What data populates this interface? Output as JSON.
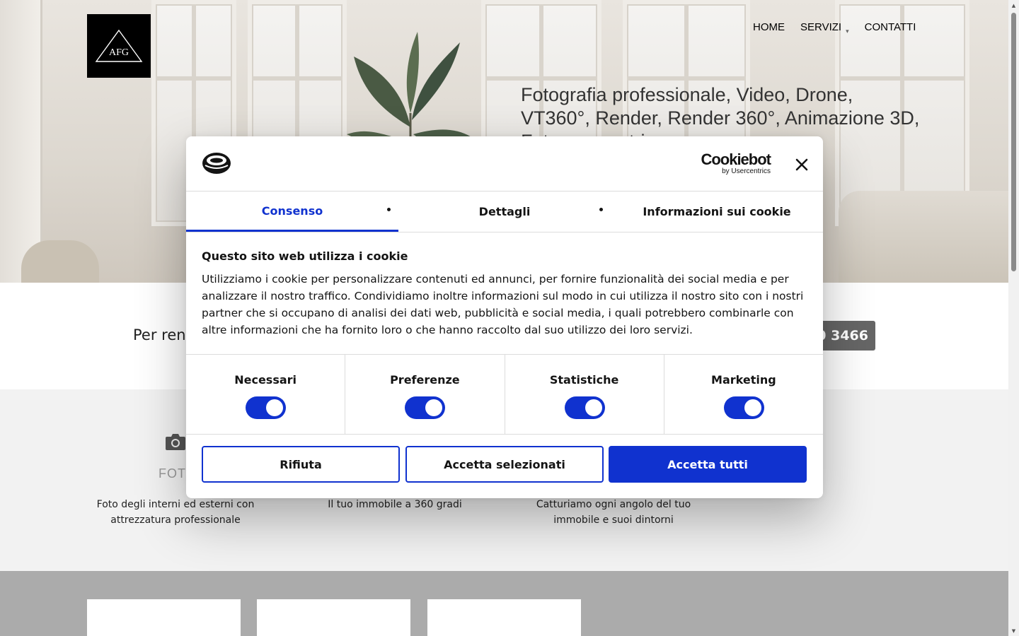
{
  "site": {
    "logo_text": "AFG",
    "nav": [
      {
        "label": "HOME"
      },
      {
        "label": "SERVIZI"
      },
      {
        "label": "CONTATTI"
      }
    ],
    "hero_text": "Fotografia professionale, Video, Drone, VT360°, Render, Render 360°, Animazione 3D, Fotogrammetria",
    "contact_text_partial": "Per rend",
    "phone_partial": "40 3466",
    "services": {
      "foto_title_partial": "FOTO",
      "descriptions": [
        "Foto degli interni ed esterni con attrezzatura professionale",
        "Il tuo immobile a 360 gradi",
        "Catturiamo ogni angolo del tuo immobile e suoi dintorni"
      ]
    }
  },
  "cookie_dialog": {
    "brand": "Cookiebot",
    "brand_sub": "by Usercentrics",
    "tabs": [
      {
        "label": "Consenso",
        "active": true
      },
      {
        "label": "Dettagli",
        "active": false
      },
      {
        "label": "Informazioni sui cookie",
        "active": false
      }
    ],
    "title": "Questo sito web utilizza i cookie",
    "body": "Utilizziamo i cookie per personalizzare contenuti ed annunci, per fornire funzionalità dei social media e per analizzare il nostro traffico. Condividiamo inoltre informazioni sul modo in cui utilizza il nostro sito con i nostri partner che si occupano di analisi dei dati web, pubblicità e social media, i quali potrebbero combinarle con altre informazioni che ha fornito loro o che hanno raccolto dal suo utilizzo dei loro servizi.",
    "toggles": [
      {
        "label": "Necessari",
        "checked": true
      },
      {
        "label": "Preferenze",
        "checked": true
      },
      {
        "label": "Statistiche",
        "checked": true
      },
      {
        "label": "Marketing",
        "checked": true
      }
    ],
    "buttons": {
      "reject": "Rifiuta",
      "accept_selected": "Accetta selezionati",
      "accept_all": "Accetta tutti"
    },
    "accent_color": "#1032cf"
  }
}
